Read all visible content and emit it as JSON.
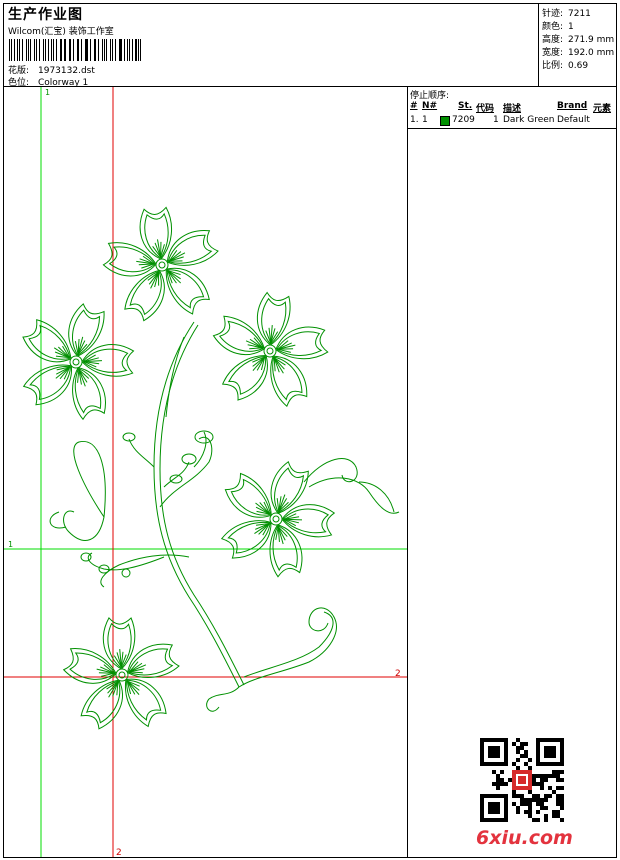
{
  "header": {
    "title": "生产作业图",
    "company": "Wilcom(汇宝) 装饰工作室",
    "design_label": "花版:",
    "design_value": "1973132.dst",
    "color_label": "色位:",
    "color_value": "Colorway 1"
  },
  "stats": [
    {
      "label": "针迹:",
      "value": "7211"
    },
    {
      "label": "颜色:",
      "value": "1"
    },
    {
      "label": "高度:",
      "value": "271.9 mm"
    },
    {
      "label": "宽度:",
      "value": "192.0 mm"
    },
    {
      "label": "比例:",
      "value": "0.69"
    }
  ],
  "stop_sequence": {
    "title": "停止顺序:",
    "columns": [
      "#",
      "N#",
      "St.",
      "代码",
      "描述",
      "Brand",
      "元素"
    ],
    "rows": [
      {
        "num": "1.",
        "n": "1",
        "color": "#009000",
        "code": "7209",
        "st": "1",
        "desc": "Dark Green",
        "brand": "Default",
        "element": ""
      }
    ]
  },
  "guides": {
    "green_label_top": "1",
    "green_label_left": "1",
    "red_label_right": "2",
    "red_label_bottom": "2"
  },
  "watermark": "6xiu.com",
  "colors": {
    "thread": "#009000",
    "guide_green": "#00dd00",
    "guide_red": "#e00000"
  }
}
